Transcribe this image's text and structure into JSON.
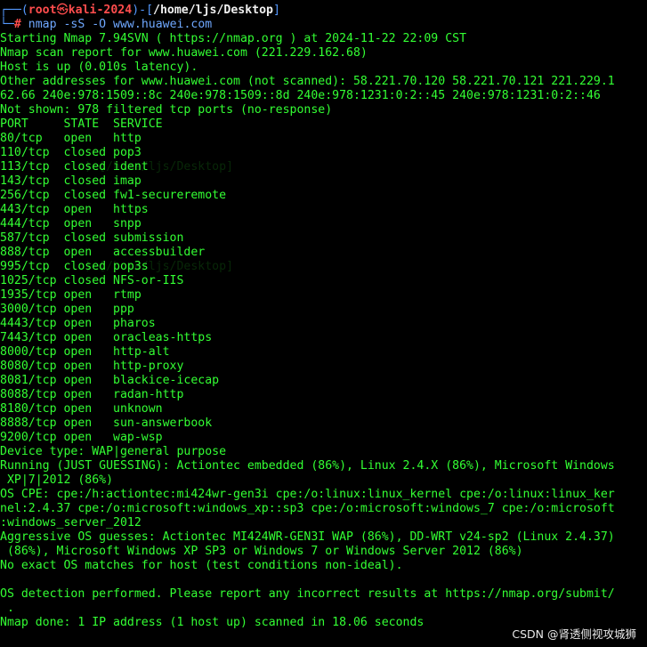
{
  "prompt": {
    "frame_open": "┌──(",
    "user": "root",
    "at": "㉿",
    "host": "kali-2024",
    "mid": ")-[",
    "path": "/home/ljs/Desktop",
    "close": "]",
    "frame_close": "└─",
    "hash": "#",
    "command": " nmap -sS -O www.huawei.com"
  },
  "output": [
    "Starting Nmap 7.94SVN ( https://nmap.org ) at 2024-11-22 22:09 CST",
    "Nmap scan report for www.huawei.com (221.229.162.68)",
    "Host is up (0.010s latency).",
    "Other addresses for www.huawei.com (not scanned): 58.221.70.120 58.221.70.121 221.229.1",
    "62.66 240e:978:1509::8c 240e:978:1509::8d 240e:978:1231:0:2::45 240e:978:1231:0:2::46",
    "Not shown: 978 filtered tcp ports (no-response)",
    "PORT     STATE  SERVICE",
    "80/tcp   open   http",
    "110/tcp  closed pop3",
    "113/tcp  closed ident",
    "143/tcp  closed imap",
    "256/tcp  closed fw1-secureremote",
    "443/tcp  open   https",
    "444/tcp  open   snpp",
    "587/tcp  closed submission",
    "888/tcp  open   accessbuilder",
    "995/tcp  closed pop3s",
    "1025/tcp closed NFS-or-IIS",
    "1935/tcp open   rtmp",
    "3000/tcp open   ppp",
    "4443/tcp open   pharos",
    "7443/tcp open   oracleas-https",
    "8000/tcp open   http-alt",
    "8080/tcp open   http-proxy",
    "8081/tcp open   blackice-icecap",
    "8088/tcp open   radan-http",
    "8180/tcp open   unknown",
    "8888/tcp open   sun-answerbook",
    "9200/tcp open   wap-wsp",
    "Device type: WAP|general purpose",
    "Running (JUST GUESSING): Actiontec embedded (86%), Linux 2.4.X (86%), Microsoft Windows",
    " XP|7|2012 (86%)",
    "OS CPE: cpe:/h:actiontec:mi424wr-gen3i cpe:/o:linux:linux_kernel cpe:/o:linux:linux_ker",
    "nel:2.4.37 cpe:/o:microsoft:windows_xp::sp3 cpe:/o:microsoft:windows_7 cpe:/o:microsoft",
    ":windows_server_2012",
    "Aggressive OS guesses: Actiontec MI424WR-GEN3I WAP (86%), DD-WRT v24-sp2 (Linux 2.4.37)",
    " (86%), Microsoft Windows XP SP3 or Windows 7 or Windows Server 2012 (86%)",
    "No exact OS matches for host (test conditions non-ideal).",
    "",
    "OS detection performed. Please report any incorrect results at https://nmap.org/submit/",
    " .",
    "Nmap done: 1 IP address (1 host up) scanned in 18.06 seconds"
  ],
  "watermark": "CSDN @肾透侧视攻城狮",
  "colors": {
    "background": "#000000",
    "output_text": "#33ff33",
    "prompt_frame": "#5599ff",
    "prompt_user": "#ff4d4d",
    "prompt_path": "#f0f0f0",
    "command_text": "#6fa8ff"
  }
}
